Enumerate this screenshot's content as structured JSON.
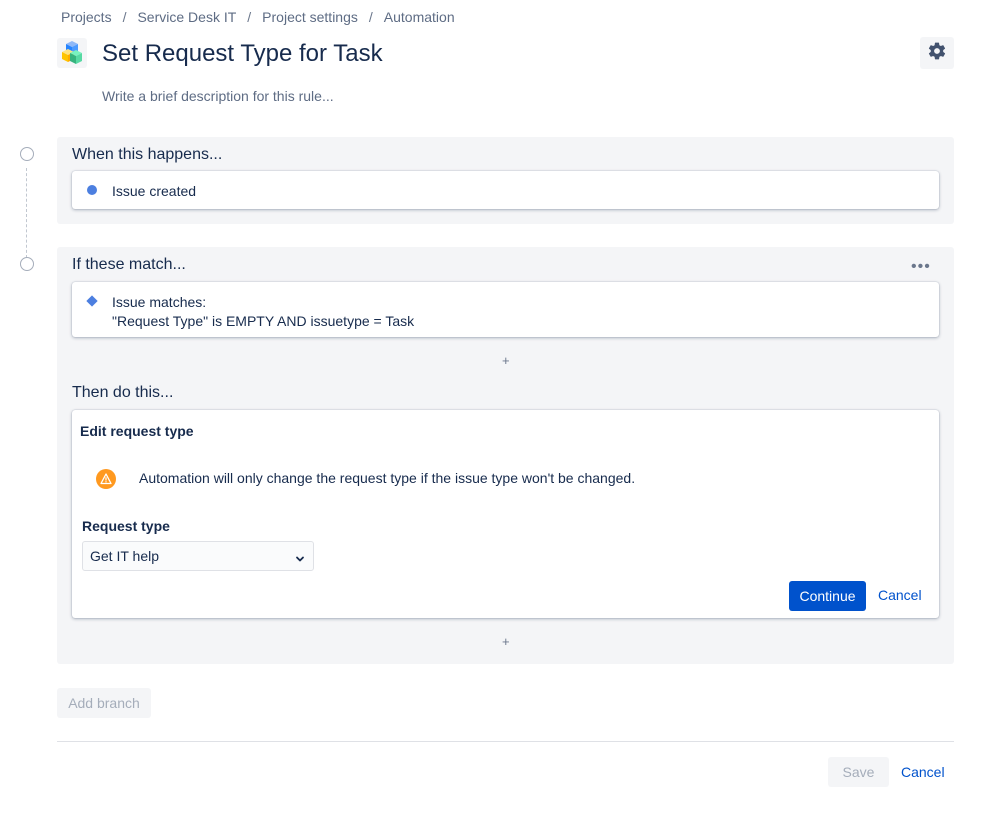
{
  "breadcrumb": {
    "items": [
      "Projects",
      "Service Desk IT",
      "Project settings",
      "Automation"
    ],
    "separator": "/"
  },
  "header": {
    "title": "Set Request Type for Task",
    "description_placeholder": "Write a brief description for this rule...",
    "project_icon": "project-cube-icon",
    "settings_icon": "gear-icon"
  },
  "trigger": {
    "heading": "When this happens...",
    "item": "Issue created"
  },
  "condition": {
    "heading": "If these match...",
    "line1": "Issue matches:",
    "line2": "\"Request Type\" is EMPTY AND issuetype = Task",
    "more_label": "•••",
    "add_label": "+"
  },
  "action": {
    "heading": "Then do this...",
    "card_title": "Edit request type",
    "warning": "Automation will only change the request type if the issue type won't be changed.",
    "field_label": "Request type",
    "selected_value": "Get IT help",
    "continue_label": "Continue",
    "cancel_label": "Cancel",
    "add_label": "+"
  },
  "footer": {
    "add_branch_label": "Add branch",
    "save_label": "Save",
    "cancel_label": "Cancel"
  },
  "colors": {
    "primary": "#0052CC",
    "section_bg": "#F4F5F7",
    "marker_blue": "#4C7FE0",
    "warning": "#FF991F"
  }
}
